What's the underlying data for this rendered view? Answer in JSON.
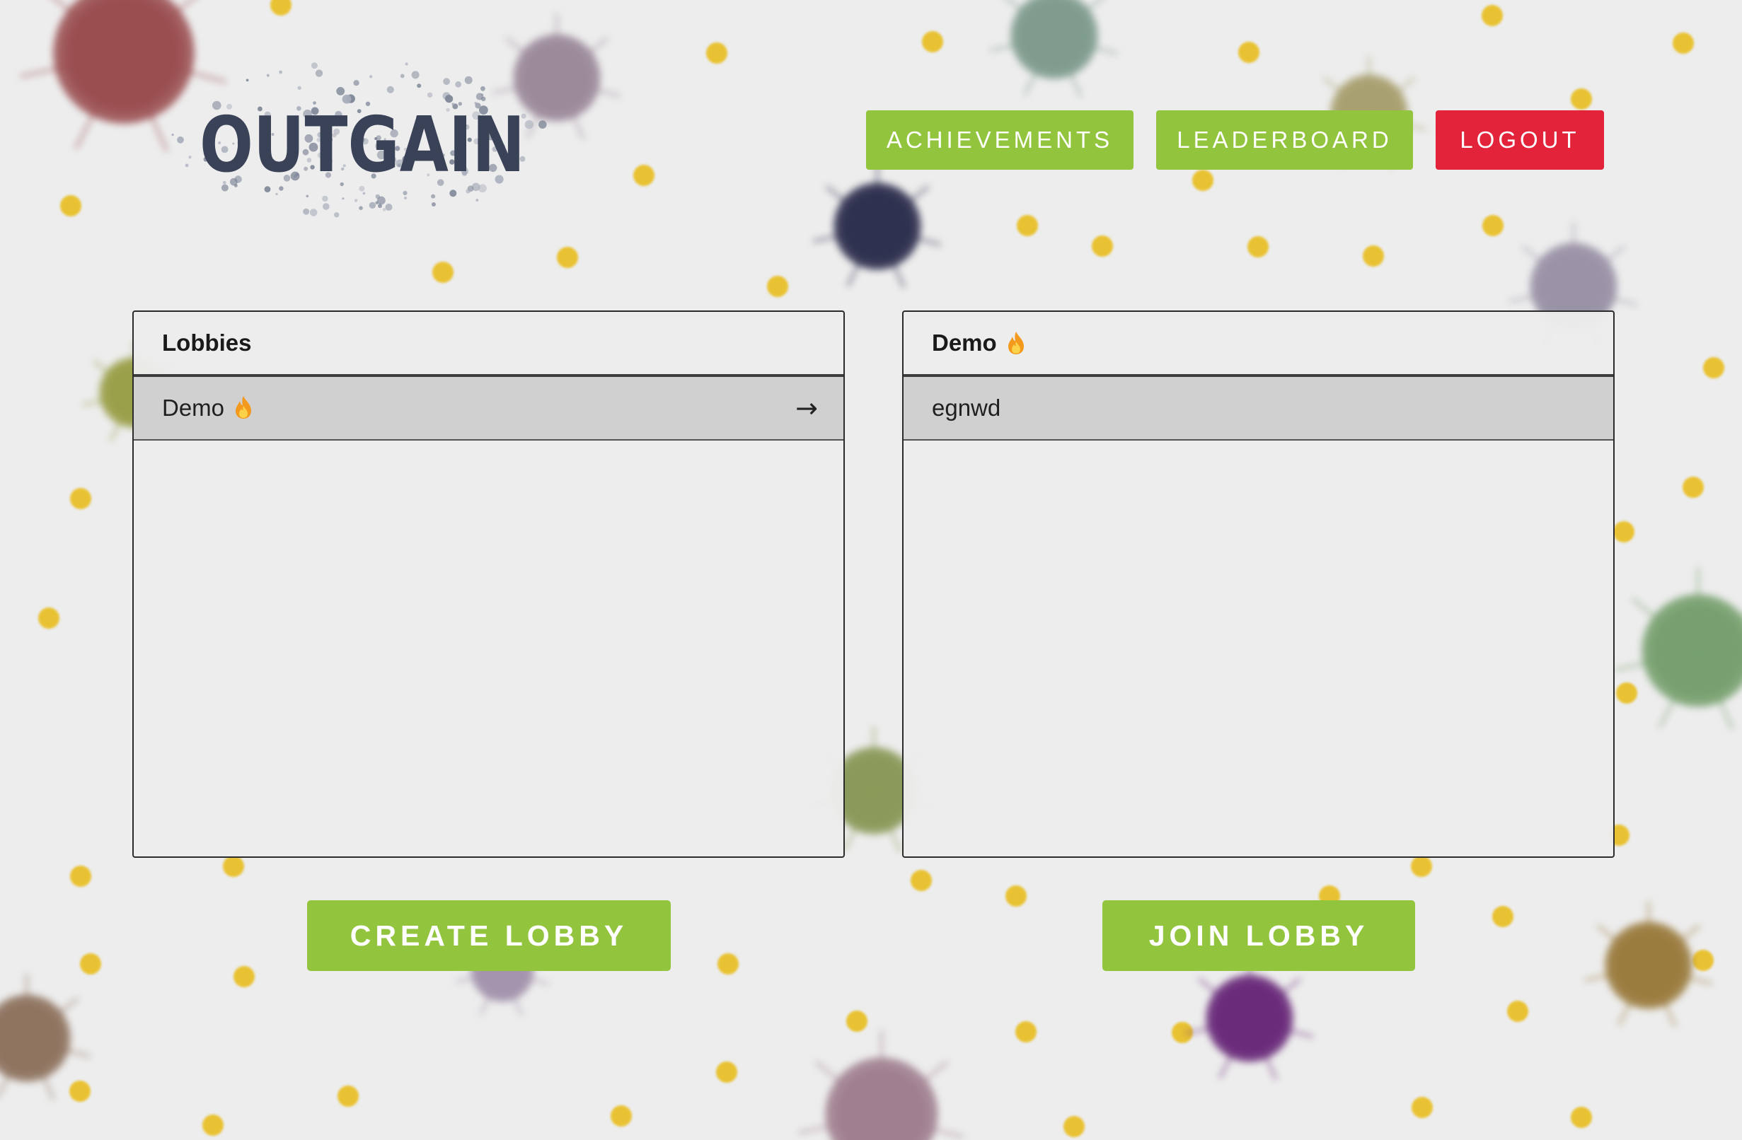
{
  "app": {
    "logo_text": "OUTGAIN"
  },
  "nav": {
    "achievements_label": "ACHIEVEMENTS",
    "leaderboard_label": "LEADERBOARD",
    "logout_label": "LOGOUT"
  },
  "lobbies_panel": {
    "title": "Lobbies",
    "items": [
      {
        "name": "Demo",
        "icon": "flame-icon",
        "action_icon": "right-arrow-icon"
      }
    ]
  },
  "lobby_detail_panel": {
    "title": "Demo",
    "title_icon": "flame-icon",
    "players": [
      {
        "name": "egnwd"
      }
    ]
  },
  "actions": {
    "create_lobby_label": "CREATE LOBBY",
    "join_lobby_label": "JOIN LOBBY"
  },
  "colors": {
    "primary_green": "#92c43e",
    "logout_red": "#e3233a",
    "background": "#ededed",
    "row_selected": "#d0d0d0"
  },
  "arrow_glyph": "→"
}
